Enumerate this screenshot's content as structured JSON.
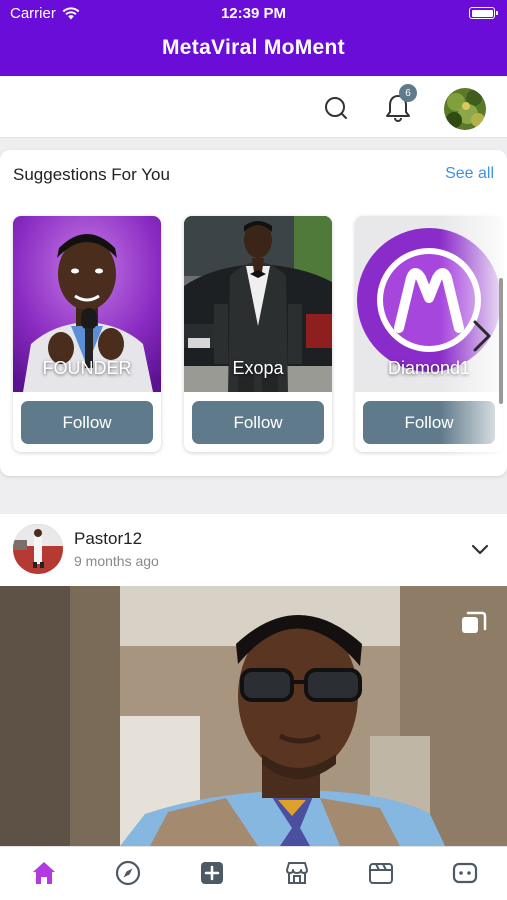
{
  "status_bar": {
    "carrier": "Carrier",
    "time": "12:39 PM"
  },
  "app": {
    "title": "MetaViral MoMent"
  },
  "header": {
    "notification_count": "6"
  },
  "suggestions": {
    "title": "Suggestions For You",
    "see_all": "See all",
    "items": [
      {
        "name": "FOUNDER",
        "follow_label": "Follow"
      },
      {
        "name": "Exopa",
        "follow_label": "Follow"
      },
      {
        "name": "Diamond1",
        "follow_label": "Follow"
      }
    ]
  },
  "post": {
    "username": "Pastor12",
    "time_ago": "9 months ago"
  },
  "tabs": [
    {
      "icon": "home-icon",
      "active": true
    },
    {
      "icon": "compass-icon"
    },
    {
      "icon": "add-square-icon"
    },
    {
      "icon": "store-icon"
    },
    {
      "icon": "clapperboard-icon"
    },
    {
      "icon": "chat-bot-icon"
    }
  ],
  "colors": {
    "brand": "#6a0dd9",
    "follow_button": "#5f7a8a",
    "link": "#3b93e6",
    "active_tab": "#b33ae0",
    "inactive_tab": "#4d5a66"
  }
}
